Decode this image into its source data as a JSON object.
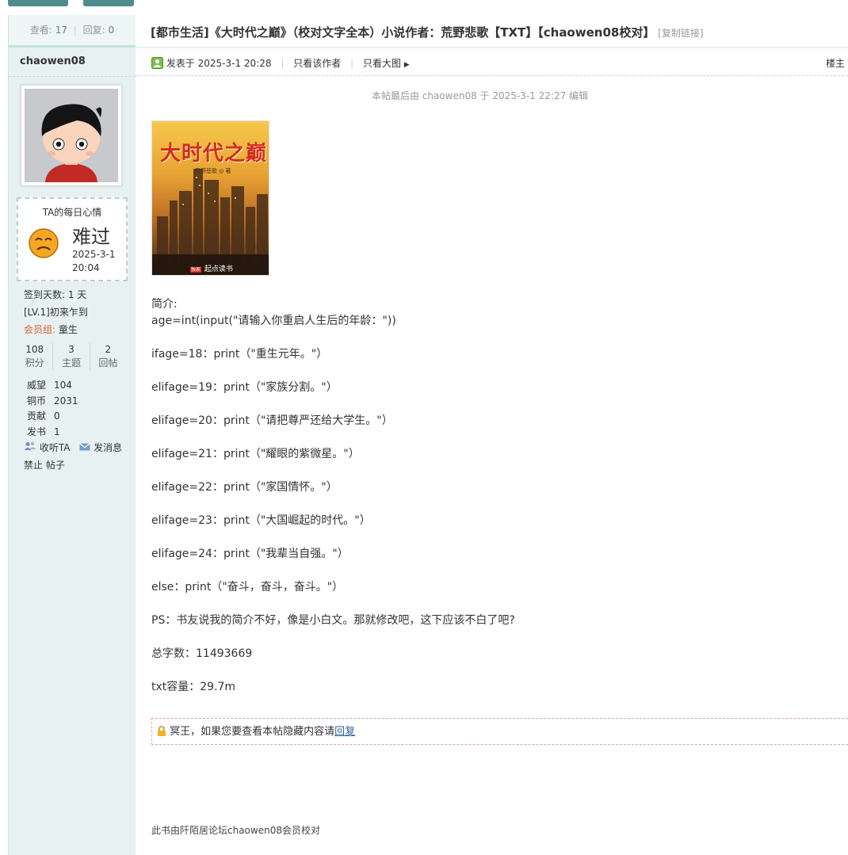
{
  "stats": {
    "views_label": "查看:",
    "views": "17",
    "replies_label": "回复:",
    "replies": "0"
  },
  "author": {
    "name": "chaowen08",
    "mood": {
      "title": "TA的每日心情",
      "word": "难过",
      "date_line1": "2025-3-1",
      "date_line2": "20:04"
    },
    "checkin": "签到天数: 1 天",
    "level": "[LV.1]初来乍到",
    "group_label": "会员组:",
    "group_value": "童生",
    "counts": [
      {
        "value": "108",
        "label": "积分"
      },
      {
        "value": "3",
        "label": "主题"
      },
      {
        "value": "2",
        "label": "回帖"
      }
    ],
    "kvs": [
      {
        "k": "威望",
        "v": "104"
      },
      {
        "k": "铜币",
        "v": "2031"
      },
      {
        "k": "贡献",
        "v": "0"
      },
      {
        "k": "发书",
        "v": "1"
      }
    ],
    "follow_label": "收听TA",
    "message_label": "发消息",
    "ban_label": "禁止",
    "posts_label": "帖子"
  },
  "post": {
    "title": "[都市生活]《大时代之巅》（校对文字全本）小说作者：荒野悲歌【TXT】【chaowen08校对】",
    "copy_link": "[复制链接]",
    "posted": "发表于 2025-3-1 20:28",
    "only_author": "只看该作者",
    "big_image": "只看大图",
    "floor": "楼主",
    "edited": "本帖最后由 chaowen08 于 2025-3-1 22:27 编辑",
    "cover_title": "大时代之巅",
    "cover_author": "荒野悲歌 ◎ 著",
    "cover_publisher": "起点读书",
    "cover_badge": "独家",
    "intro_label": "简介:",
    "lines": [
      "age=int(input(\"请输入你重启人生后的年龄：\"))",
      "ifage=18：print（\"重生元年。\"）",
      "elifage=19：print（\"家族分割。\"）",
      "elifage=20：print（\"请把尊严还给大学生。\"）",
      "elifage=21：print（\"耀眼的紫微星。\"）",
      "elifage=22：print（\"家国情怀。\"）",
      "elifage=23：print（\"大国崛起的时代。\"）",
      "elifage=24：print（\"我辈当自强。\"）",
      "else：print（\"奋斗，奋斗，奋斗。\"）",
      "PS：书友说我的简介不好，像是小白文。那就修改吧，这下应该不白了吧?",
      "总字数：11493669",
      "txt容量：29.7m"
    ],
    "hidden_text": "冥王，如果您要查看本帖隐藏内容请",
    "hidden_link": "回复",
    "footer": "此书由阡陌居论坛chaowen08会员校对"
  },
  "colors": {
    "accent": "#4e8d8b",
    "sidebar_bg": "#e7f1f1",
    "link": "#336699",
    "group_label": "#e0603a"
  }
}
